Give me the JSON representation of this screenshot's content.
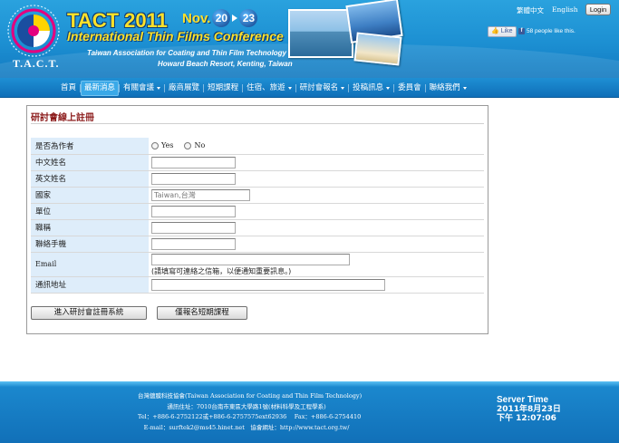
{
  "header": {
    "logo_text": "T.A.C.T.",
    "title_main": "TACT 2011",
    "date_prefix": "Nov.",
    "date_start": "20",
    "date_end": "23",
    "title_sub": "International Thin Films Conference",
    "association": "Taiwan Association for Coating and Thin Film Technology",
    "venue": "Howard Beach Resort, Kenting, Taiwan",
    "lang_zh": "繁體中文",
    "lang_en": "English",
    "login_label": "Login",
    "fb_like_label": "Like",
    "fb_count_text": "58 people like this."
  },
  "nav": {
    "items": [
      {
        "label": "首頁",
        "has_caret": false
      },
      {
        "label": "最新消息",
        "has_caret": false
      },
      {
        "label": "有關會議",
        "has_caret": true
      },
      {
        "label": "廠商展覽",
        "has_caret": false
      },
      {
        "label": "短期課程",
        "has_caret": false
      },
      {
        "label": "住宿、旅遊",
        "has_caret": true
      },
      {
        "label": "研討會報名",
        "has_caret": true
      },
      {
        "label": "投稿訊息",
        "has_caret": true
      },
      {
        "label": "委員會",
        "has_caret": false
      },
      {
        "label": "聯絡我們",
        "has_caret": true
      }
    ],
    "active_index": 1
  },
  "form": {
    "title": "研討會線上註冊",
    "author_label": "是否為作者",
    "author_yes": "Yes",
    "author_no": "No",
    "name_zh_label": "中文姓名",
    "name_en_label": "英文姓名",
    "country_label": "國家",
    "country_value": "Taiwan,台灣",
    "org_label": "單位",
    "position_label": "職稱",
    "mobile_label": "聯絡手機",
    "email_label": "Email",
    "email_note": "(請填寫可連絡之信箱，以便通知重要訊息。)",
    "address_label": "通訊地址",
    "btn_register": "進入研討會註冊系統",
    "btn_short_course": "僅報名短期課程"
  },
  "footer": {
    "org": "台灣鍍膜科技協會(Taiwan Association for Coating and Thin Film Technology)",
    "address": "通訊住址：7010台南市東區大學路1號(材料科學及工程學系)",
    "tel_fax": "Tel：+886-6-2752122或+886-6-2757575ext62936　 Fax：+886-6-2754410",
    "email_web": "E-mail：surftek2@ms45.hinet.net　協會網址：http://www.tact.org.tw/",
    "server_time_label": "Server Time",
    "server_date": "2011年8月23日",
    "server_clock": "下午 12:07:06"
  },
  "colors": {
    "header_blue": "#1c8fd2",
    "title_yellow": "#ffe12a",
    "form_title_red": "#8b1a1a",
    "label_bg": "#deedfa"
  }
}
